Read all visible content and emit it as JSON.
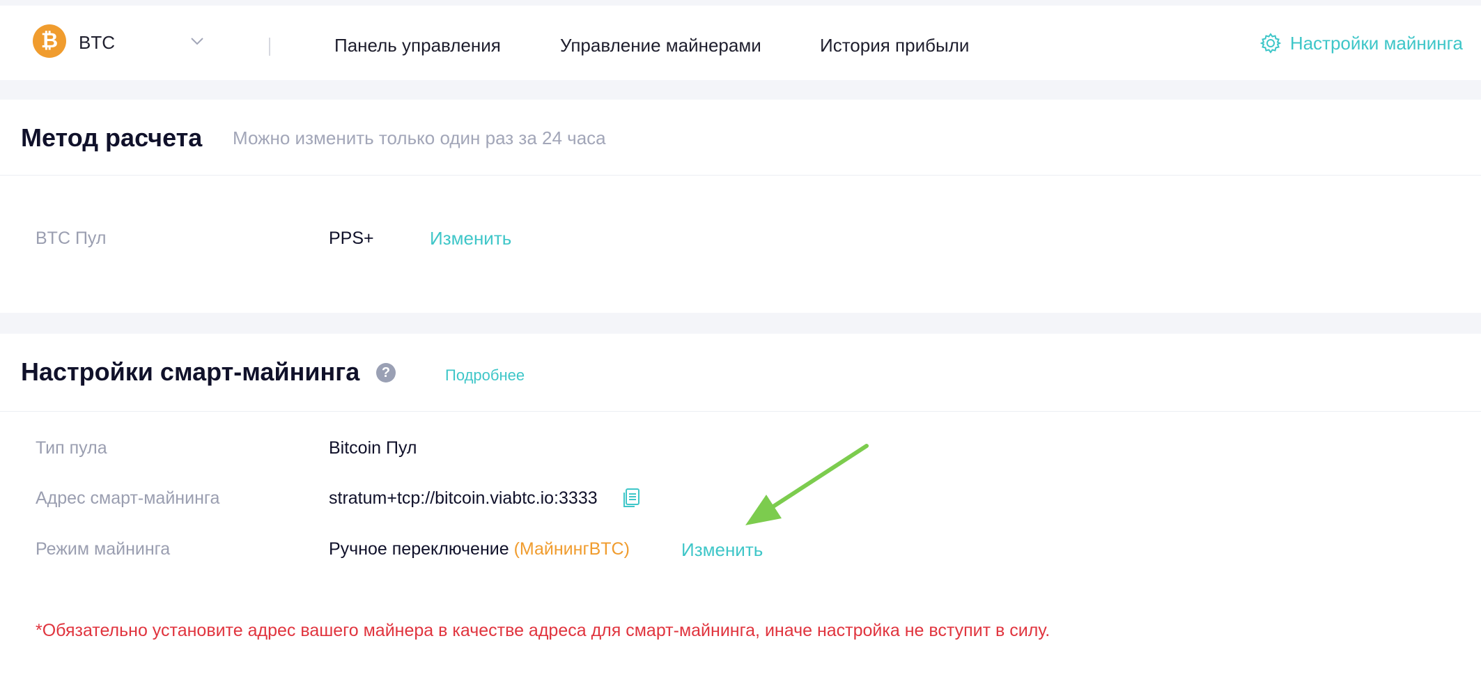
{
  "header": {
    "coin": {
      "symbol": "BTC",
      "logo_glyph": "₿",
      "logo_color": "#f09c2e"
    },
    "nav": [
      {
        "label": "Панель управления"
      },
      {
        "label": "Управление майнерами"
      },
      {
        "label": "История прибыли"
      }
    ],
    "settings_label": "Настройки майнинга",
    "settings_icon": "gear-icon"
  },
  "payment_method": {
    "title": "Метод расчета",
    "subtitle": "Можно изменить только один раз за 24 часа",
    "pool_label": "BTC Пул",
    "pool_value": "PPS+",
    "change_label": "Изменить"
  },
  "smart_mining": {
    "title": "Настройки смарт-майнинга",
    "help_glyph": "?",
    "more_label": "Подробнее",
    "rows": {
      "pool_type": {
        "label": "Тип пула",
        "value": "Bitcoin Пул"
      },
      "address": {
        "label": "Адрес смарт-майнинга",
        "value": "stratum+tcp://bitcoin.viabtc.io:3333"
      },
      "mode": {
        "label": "Режим майнинга",
        "value": "Ручное переключение",
        "suffix": "(МайнингBTC)",
        "change_label": "Изменить"
      }
    },
    "warning": "*Обязательно установите адрес вашего майнера в качестве адреса для смарт-майнинга, иначе настройка не вступит в силу."
  },
  "colors": {
    "accent": "#3ec6c8",
    "bitcoin_orange": "#f09c2e",
    "warning_red": "#e0343e",
    "annotation_arrow": "#7ccc4e"
  }
}
